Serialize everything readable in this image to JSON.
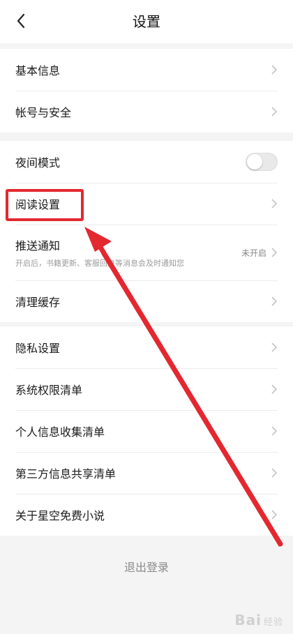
{
  "header": {
    "title": "设置",
    "back_icon": "chevron-left-icon"
  },
  "group1": [
    {
      "label": "基本信息"
    },
    {
      "label": "帐号与安全"
    }
  ],
  "group2": {
    "night_mode": {
      "label": "夜间模式",
      "enabled": false
    },
    "reading": {
      "label": "阅读设置"
    },
    "push": {
      "label": "推送通知",
      "subtitle": "开启后，书籍更新、客服回复等消息会及时通知您",
      "status": "未开启"
    },
    "cache": {
      "label": "清理缓存"
    }
  },
  "group3": [
    {
      "label": "隐私设置"
    },
    {
      "label": "系统权限清单"
    },
    {
      "label": "个人信息收集清单"
    },
    {
      "label": "第三方信息共享清单"
    },
    {
      "label": "关于星空免费小说"
    }
  ],
  "logout": {
    "label": "退出登录"
  },
  "watermark": {
    "brand": "Bai",
    "suffix": "经验"
  },
  "annotation": {
    "color": "#e3282f"
  }
}
